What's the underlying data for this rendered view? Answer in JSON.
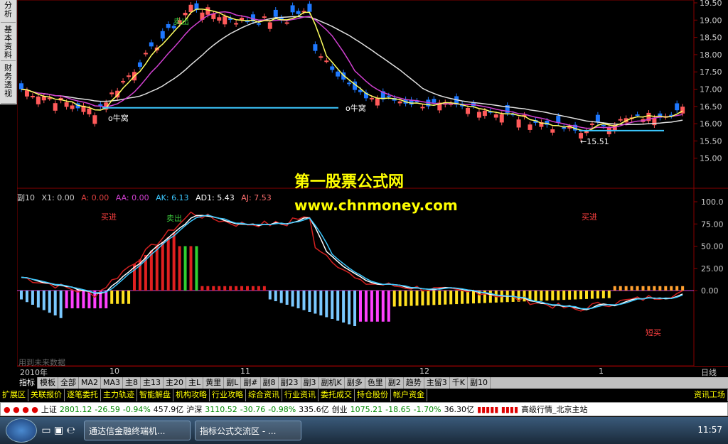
{
  "side": {
    "tab1": "分析",
    "tab2": "基本资料",
    "tab3": "财务透视"
  },
  "price_axis": [
    "19.50",
    "19.00",
    "18.50",
    "18.00",
    "17.50",
    "17.00",
    "16.50",
    "16.00",
    "15.50",
    "15.00"
  ],
  "ind_axis": [
    "100.0",
    "75.00",
    "50.00",
    "25.00",
    "0.00"
  ],
  "price_annotations": {
    "niu1": "o牛窝",
    "niu2": "o牛窝",
    "sell": "卖出",
    "low": "←15.51"
  },
  "indicator": {
    "name": "副10",
    "x1": "X1: 0.00",
    "a": "A: 0.00",
    "aa": "AA: 0.00",
    "ak": "AK: 6.13",
    "ad1": "AD1: 5.43",
    "aj": "AJ: 7.53"
  },
  "ind_annotations": {
    "buy1": "买进",
    "buy2": "买进",
    "sell": "卖出",
    "short": "短买",
    "future": "用到未来数据"
  },
  "watermark": {
    "line1": "第一股票公式网",
    "line2": "www.chnmoney.com"
  },
  "dates": [
    "2010年",
    "10",
    "11",
    "12",
    "1",
    "日线"
  ],
  "tabs1": [
    "指标",
    "模板",
    "全部",
    "MA2",
    "MA3",
    "主8",
    "主13",
    "主20",
    "主L",
    "黄里",
    "副L",
    "副#",
    "副8",
    "副23",
    "副3",
    "副机K",
    "副多",
    "色里",
    "副2",
    "趋势",
    "主留3",
    "千K",
    "副10"
  ],
  "tabs2": [
    "扩展区",
    "关联报价",
    "逐笔委托",
    "主力轨迹",
    "智能解盘",
    "机构攻略",
    "行业攻略",
    "综合资讯",
    "行业资讯",
    "委托成交",
    "持仓股份",
    "帐户资金",
    "资讯工场"
  ],
  "ticker": {
    "sh": "上证",
    "sh_val": "2801.12",
    "sh_chg": "-26.59",
    "sh_pct": "-0.94%",
    "sh_amt": "457.9亿",
    "sz": "沪深",
    "sz_val": "3110.52",
    "sz_chg": "-30.76",
    "sz_pct": "-0.98%",
    "sz_amt": "335.6亿",
    "cy": "创业",
    "cy_val": "1075.21",
    "cy_chg": "-18.65",
    "cy_pct": "-1.70%",
    "cy_amt": "36.30亿",
    "site": "高级行情_北京主站"
  },
  "taskbar": {
    "task1": "通达信金融终端机...",
    "task2": "指标公式交流区 - ...",
    "time": "11:57"
  },
  "colors": {
    "up": "#ff5a5a",
    "down": "#1e78ff",
    "ma_pink": "#d040d0",
    "ma_white": "#e0e0e0",
    "ma_yellow": "#ffff60",
    "support": "#3cc8ff"
  }
}
